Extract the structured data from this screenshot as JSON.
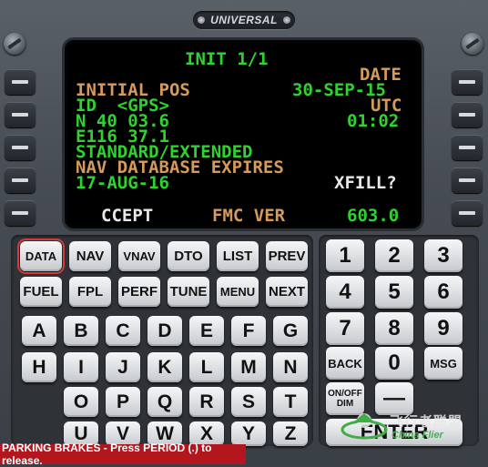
{
  "brand": {
    "name": "UNIVERSAL"
  },
  "screen": {
    "title": "INIT 1/1",
    "date_label": "DATE",
    "date_value": "30-SEP-15",
    "initial_pos_label": "INITIAL POS",
    "id_text": "ID  <GPS>",
    "utc_label": "UTC",
    "lat": "N 40 03.6",
    "time_value": "01:02",
    "lon": "E116 37.1",
    "standard_extended": "STANDARD/EXTENDED",
    "nav_db_label": "NAV DATABASE EXPIRES",
    "nav_db_date": "17-AUG-16",
    "xfill": "XFILL?",
    "accept": "CCEPT",
    "fmc_ver_label": "FMC VER",
    "fmc_ver_value": "603.0"
  },
  "function_keys": {
    "row1": [
      "DATA",
      "NAV",
      "VNAV",
      "DTO",
      "LIST",
      "PREV"
    ],
    "row2": [
      "FUEL",
      "FPL",
      "PERF",
      "TUNE",
      "MENU",
      "NEXT"
    ]
  },
  "alpha_keys": [
    [
      "A",
      "B",
      "C",
      "D",
      "E",
      "F",
      "G"
    ],
    [
      "H",
      "I",
      "J",
      "K",
      "L",
      "M",
      "N"
    ],
    [
      "O",
      "P",
      "Q",
      "R",
      "S",
      "T"
    ],
    [
      "U",
      "V",
      "W",
      "X",
      "Y",
      "Z"
    ]
  ],
  "num_keys": [
    [
      "1",
      "2",
      "3"
    ],
    [
      "4",
      "5",
      "6"
    ],
    [
      "7",
      "8",
      "9"
    ],
    [
      "BACK",
      "0",
      "MSG"
    ]
  ],
  "extra_keys": {
    "dim": "ON/OFF DIM",
    "minus": "—",
    "enter": "ENTER"
  },
  "status_bar": {
    "text": "PARKING BRAKES - Press PERIOD (.) to release."
  },
  "watermark": {
    "cn": "飞行者联盟",
    "en": "China Flier"
  }
}
